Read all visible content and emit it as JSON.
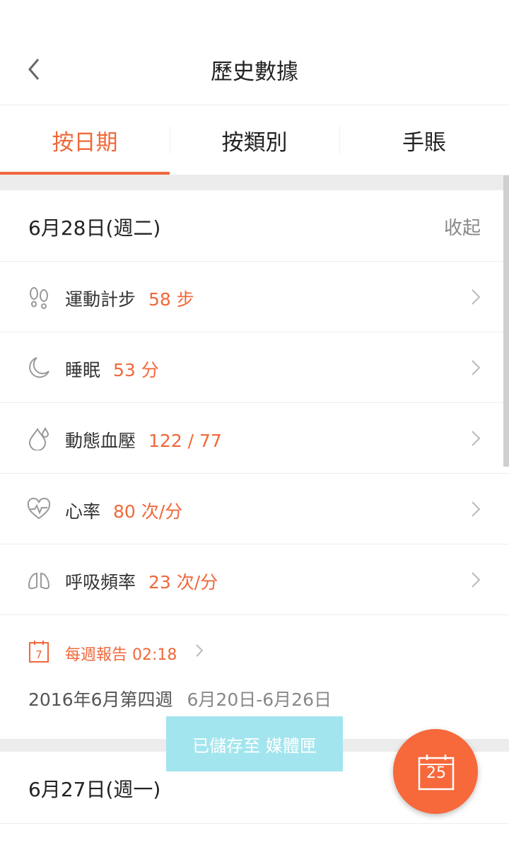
{
  "header": {
    "title": "歷史數據"
  },
  "tabs": [
    {
      "label": "按日期",
      "active": true
    },
    {
      "label": "按類別",
      "active": false
    },
    {
      "label": "手賬",
      "active": false
    }
  ],
  "day1": {
    "date": "6月28日(週二)",
    "collapse_label": "收起",
    "metrics": [
      {
        "label": "運動計步",
        "value": "58 步",
        "icon": "footsteps-icon"
      },
      {
        "label": "睡眠",
        "value": "53 分",
        "icon": "moon-icon"
      },
      {
        "label": "動態血壓",
        "value": "122 / 77",
        "icon": "droplet-icon"
      },
      {
        "label": "心率",
        "value": "80 次/分",
        "icon": "heart-pulse-icon"
      },
      {
        "label": "呼吸頻率",
        "value": "23 次/分",
        "icon": "lungs-icon"
      }
    ],
    "weekly": {
      "calendar_number": "7",
      "title": "每週報告",
      "time": "02:18",
      "week_label": "2016年6月第四週",
      "range": "6月20日-6月26日"
    }
  },
  "day2": {
    "date": "6月27日(週一)"
  },
  "toast": {
    "text": "已儲存至 媒體匣"
  },
  "fab": {
    "calendar_number": "25"
  },
  "colors": {
    "accent": "#f0683b",
    "toast_bg": "#a3e5ee",
    "separator": "#ececec"
  }
}
